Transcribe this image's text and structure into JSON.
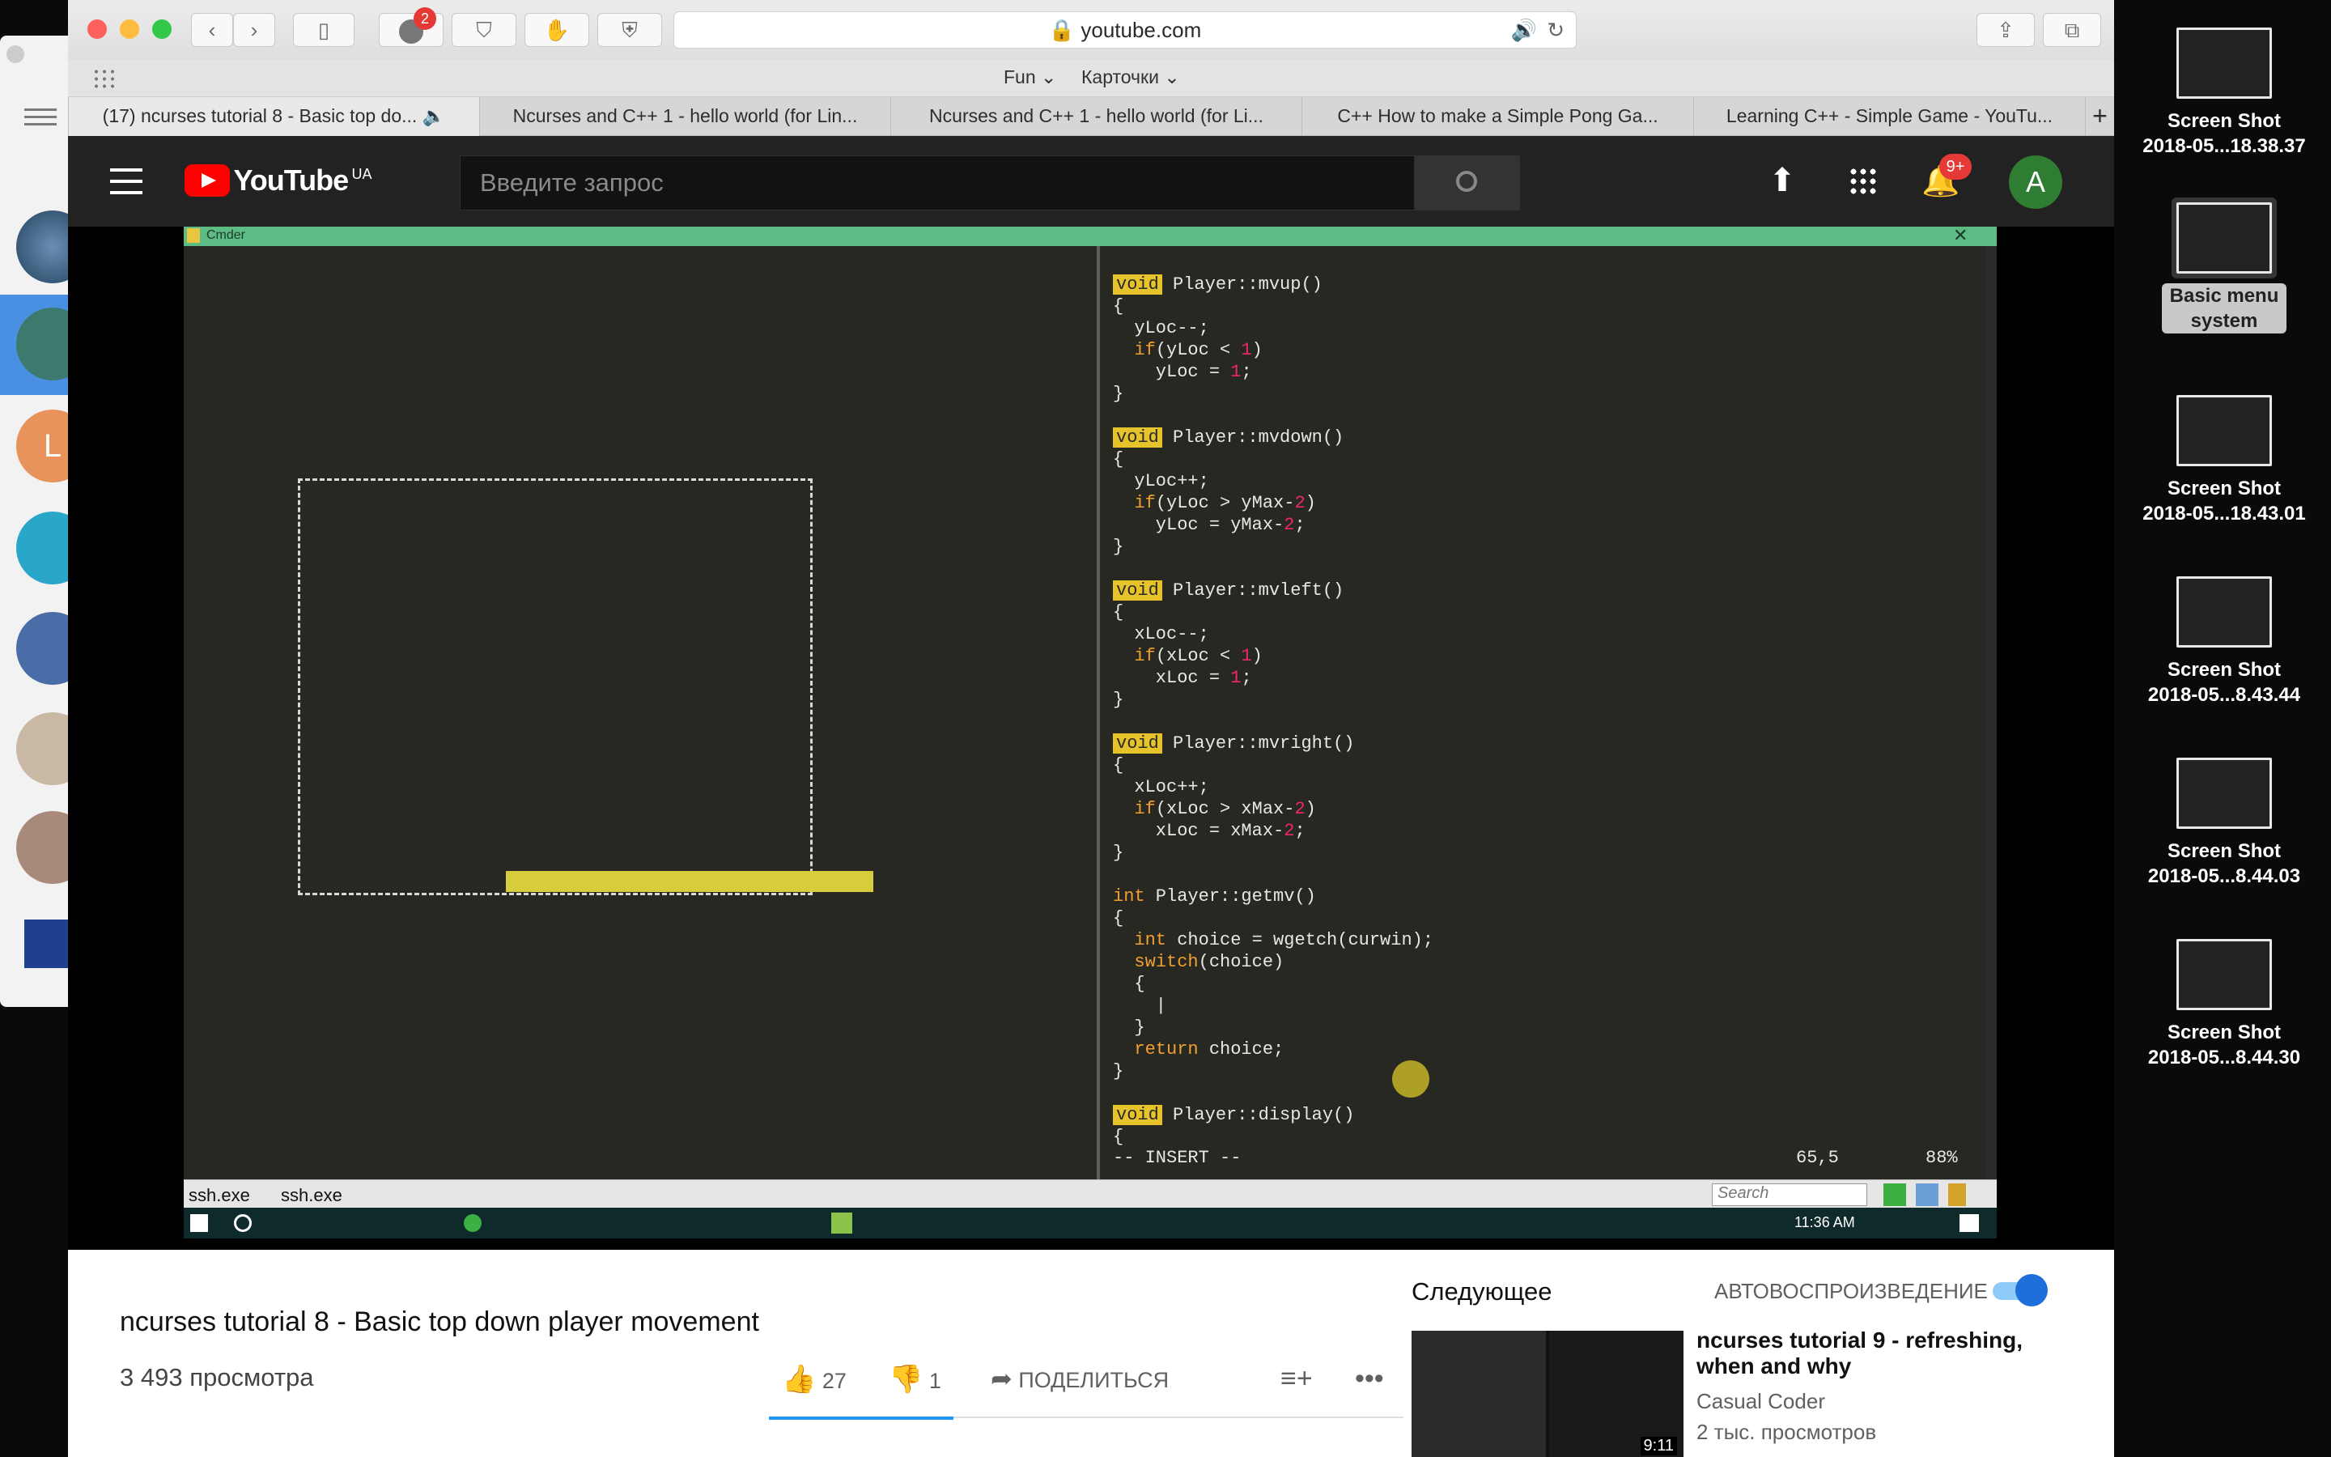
{
  "browser": {
    "url": "youtube.com",
    "abp_badge": "2",
    "favorites": [
      "Fun",
      "Карточки"
    ],
    "tabs": [
      {
        "label": "(17) ncurses tutorial 8 - Basic top do...",
        "active": true
      },
      {
        "label": "Ncurses and C++ 1 - hello world (for Lin..."
      },
      {
        "label": "Ncurses and C++ 1 - hello world (for Li..."
      },
      {
        "label": "C++ How to make a Simple Pong Ga..."
      },
      {
        "label": "Learning C++ - Simple Game - YouTu..."
      }
    ],
    "new_tab": "+"
  },
  "youtube": {
    "logo_text": "YouTube",
    "region": "UA",
    "search_placeholder": "Введите запрос",
    "notifications_badge": "9+",
    "avatar_letter": "A",
    "video_title": "ncurses tutorial 8 - Basic top down player movement",
    "views": "3 493 просмотра",
    "likes": "27",
    "dislikes": "1",
    "share": "ПОДЕЛИТЬСЯ",
    "up_next_label": "Следующее",
    "autoplay_label": "АВТОВОСПРОИЗВЕДЕНИЕ",
    "autoplay_on": true,
    "next_title": "ncurses tutorial 9 - refreshing, when and why",
    "next_channel": "Casual Coder",
    "next_views": "2 тыс. просмотров",
    "next_duration": "9:11"
  },
  "cmder": {
    "title": "Cmder",
    "status_mode": "-- INSERT --",
    "status_pos": "65,5",
    "status_pct": "88%",
    "tabs": [
      "ssh.exe",
      "ssh.exe"
    ],
    "search_placeholder": "Search",
    "clock": "11:36 AM"
  },
  "desktop": {
    "icons": [
      {
        "line1": "Screen Shot",
        "line2": "2018-05...18.38.37"
      },
      {
        "line1": "Basic menu",
        "line2": "system",
        "selected": true
      },
      {
        "line1": "Screen Shot",
        "line2": "2018-05...18.43.01"
      },
      {
        "line1": "Screen Shot",
        "line2": "2018-05...8.43.44"
      },
      {
        "line1": "Screen Shot",
        "line2": "2018-05...8.44.03"
      },
      {
        "line1": "Screen Shot",
        "line2": "2018-05...8.44.30"
      }
    ]
  },
  "sidebar_avatars": [
    "L"
  ]
}
